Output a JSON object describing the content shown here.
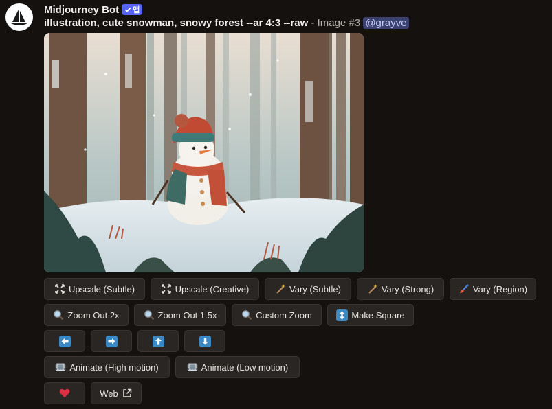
{
  "message": {
    "author": "Midjourney Bot",
    "app_tag": "앱",
    "prompt": "illustration, cute snowman, snowy forest --ar 4:3 --raw",
    "suffix": "- Image #3",
    "mention": "@grayve"
  },
  "buttons": {
    "row1": [
      {
        "label": "Upscale (Subtle)",
        "icon": "upscale-icon"
      },
      {
        "label": "Upscale (Creative)",
        "icon": "upscale-icon"
      },
      {
        "label": "Vary (Subtle)",
        "icon": "magic-wand-icon"
      },
      {
        "label": "Vary (Strong)",
        "icon": "magic-wand-icon"
      },
      {
        "label": "Vary (Region)",
        "icon": "paintbrush-icon"
      }
    ],
    "row2": [
      {
        "label": "Zoom Out 2x",
        "icon": "magnifier-icon"
      },
      {
        "label": "Zoom Out 1.5x",
        "icon": "magnifier-icon"
      },
      {
        "label": "Custom Zoom",
        "icon": "magnifier-icon"
      },
      {
        "label": "Make Square",
        "icon": "up-down-arrow-icon"
      }
    ],
    "row3": [
      {
        "icon": "arrow-left-icon"
      },
      {
        "icon": "arrow-right-icon"
      },
      {
        "icon": "arrow-up-icon"
      },
      {
        "icon": "arrow-down-icon"
      }
    ],
    "row4": [
      {
        "label": "Animate (High motion)",
        "icon": "film-icon"
      },
      {
        "label": "Animate (Low motion)",
        "icon": "film-icon"
      }
    ],
    "row5": [
      {
        "icon": "heart-icon"
      },
      {
        "label": "Web",
        "icon": "external-link-icon"
      }
    ]
  },
  "colors": {
    "background": "#14110f",
    "button": "#2a2624",
    "app_tag": "#5865f2",
    "arrow_blue": "#3b88c3",
    "heart": "#dd2e44"
  }
}
